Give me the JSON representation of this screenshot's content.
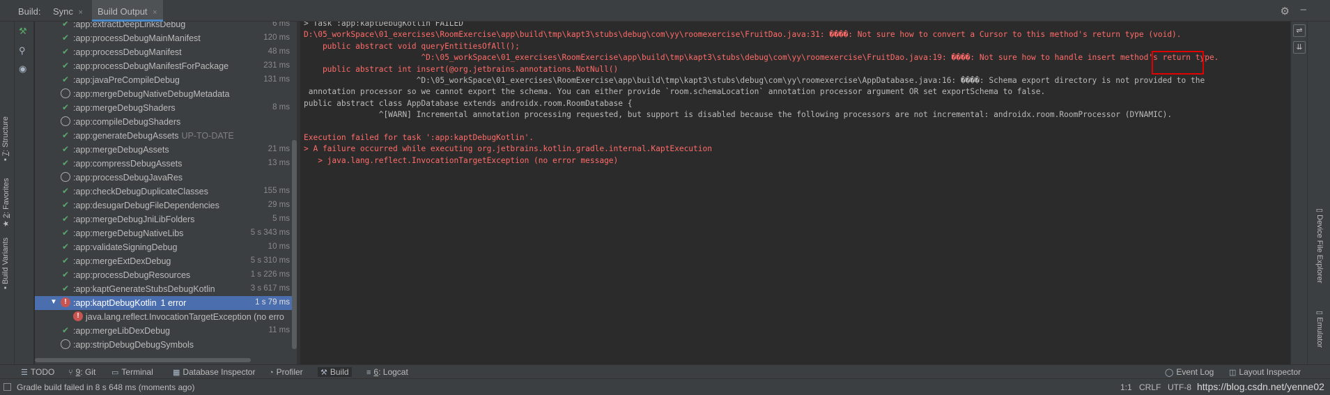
{
  "header": {
    "build_label": "Build:",
    "tabs": [
      {
        "label": "Sync"
      },
      {
        "label": "Build Output"
      }
    ],
    "close_glyph": "×"
  },
  "left_strip": {
    "tabs": [
      {
        "num": "7",
        "label": ": Structure"
      },
      {
        "num": "2",
        "label": ": Favorites"
      },
      {
        "num": "",
        "label": "Build Variants"
      }
    ]
  },
  "tree": {
    "rows": [
      {
        "name": ":app:extractDeepLinksDebug",
        "time": "6 ms",
        "status": "ok"
      },
      {
        "name": ":app:processDebugMainManifest",
        "time": "120 ms",
        "status": "ok"
      },
      {
        "name": ":app:processDebugManifest",
        "time": "48 ms",
        "status": "ok"
      },
      {
        "name": ":app:processDebugManifestForPackage",
        "time": "231 ms",
        "status": "ok"
      },
      {
        "name": ":app:javaPreCompileDebug",
        "time": "131 ms",
        "status": "ok"
      },
      {
        "name": ":app:mergeDebugNativeDebugMetadata",
        "time": "",
        "status": "skip"
      },
      {
        "name": ":app:mergeDebugShaders",
        "time": "8 ms",
        "status": "ok"
      },
      {
        "name": ":app:compileDebugShaders",
        "time": "",
        "status": "skip"
      },
      {
        "name": ":app:generateDebugAssets",
        "suffix": "UP-TO-DATE",
        "time": "",
        "status": "ok"
      },
      {
        "name": ":app:mergeDebugAssets",
        "time": "21 ms",
        "status": "ok"
      },
      {
        "name": ":app:compressDebugAssets",
        "time": "13 ms",
        "status": "ok"
      },
      {
        "name": ":app:processDebugJavaRes",
        "time": "",
        "status": "skip"
      },
      {
        "name": ":app:checkDebugDuplicateClasses",
        "time": "155 ms",
        "status": "ok"
      },
      {
        "name": ":app:desugarDebugFileDependencies",
        "time": "29 ms",
        "status": "ok"
      },
      {
        "name": ":app:mergeDebugJniLibFolders",
        "time": "5 ms",
        "status": "ok"
      },
      {
        "name": ":app:mergeDebugNativeLibs",
        "time": "5 s 343 ms",
        "status": "ok"
      },
      {
        "name": ":app:validateSigningDebug",
        "time": "10 ms",
        "status": "ok"
      },
      {
        "name": ":app:mergeExtDexDebug",
        "time": "5 s 310 ms",
        "status": "ok"
      },
      {
        "name": ":app:processDebugResources",
        "time": "1 s 226 ms",
        "status": "ok"
      },
      {
        "name": ":app:kaptGenerateStubsDebugKotlin",
        "time": "3 s 617 ms",
        "status": "ok"
      },
      {
        "name": ":app:kaptDebugKotlin",
        "errors": "1 error",
        "time": "1 s 79 ms",
        "status": "err",
        "selected": true
      },
      {
        "name": "java.lang.reflect.InvocationTargetException (no erro",
        "time": "",
        "status": "err",
        "child": true
      },
      {
        "name": ":app:mergeLibDexDebug",
        "time": "11 ms",
        "status": "ok"
      },
      {
        "name": ":app:stripDebugDebugSymbols",
        "time": "",
        "status": "skip"
      }
    ]
  },
  "console": {
    "lines": [
      {
        "text": "> Task :app:kaptDebugKotlin FAILED",
        "color": "white"
      },
      {
        "text": "D:\\05_workSpace\\01_exercises\\RoomExercise\\app\\build\\tmp\\kapt3\\stubs\\debug\\com\\yy\\roomexercise\\FruitDao.java:31: ����: Not sure how to convert a Cursor to this method's return type (void).",
        "color": "red"
      },
      {
        "text": "    public abstract void queryEntitiesOfAll();",
        "color": "red"
      },
      {
        "text": "                         ^D:\\05_workSpace\\01_exercises\\RoomExercise\\app\\build\\tmp\\kapt3\\stubs\\debug\\com\\yy\\roomexercise\\FruitDao.java:19: ����: Not sure how to handle insert method's return type.",
        "color": "red"
      },
      {
        "text": "    public abstract int insert(@org.jetbrains.annotations.NotNull()",
        "color": "red"
      },
      {
        "text": "                        ^D:\\05_workSpace\\01_exercises\\RoomExercise\\app\\build\\tmp\\kapt3\\stubs\\debug\\com\\yy\\roomexercise\\AppDatabase.java:16: ����: Schema export directory is not provided to the",
        "color": "white"
      },
      {
        "text": " annotation processor so we cannot export the schema. You can either provide `room.schemaLocation` annotation processor argument OR set exportSchema to false.",
        "color": "white"
      },
      {
        "text": "public abstract class AppDatabase extends androidx.room.RoomDatabase {",
        "color": "white"
      },
      {
        "text": "                ^[WARN] Incremental annotation processing requested, but support is disabled because the following processors are not incremental: androidx.room.RoomProcessor (DYNAMIC).",
        "color": "white"
      },
      {
        "text": "",
        "color": "white"
      },
      {
        "text": "Execution failed for task ':app:kaptDebugKotlin'.",
        "color": "red"
      },
      {
        "text": "> A failure occurred while executing org.jetbrains.kotlin.gradle.internal.KaptExecution",
        "color": "red"
      },
      {
        "text": "   > java.lang.reflect.InvocationTargetException (no error message)",
        "color": "red"
      }
    ]
  },
  "right_strip": {
    "tabs": [
      {
        "label": "Device File Explorer"
      },
      {
        "label": "Emulator"
      }
    ]
  },
  "bottom_tools": [
    {
      "label": "TODO",
      "icon": "list-icon",
      "glyph": "☰"
    },
    {
      "num": "9",
      "label": ": Git",
      "icon": "git-icon",
      "glyph": "⑂"
    },
    {
      "label": "Terminal",
      "icon": "terminal-icon",
      "glyph": "▭"
    },
    {
      "label": "Database Inspector",
      "icon": "database-icon",
      "glyph": "▦"
    },
    {
      "label": "Profiler",
      "icon": "profiler-icon",
      "glyph": "◔"
    },
    {
      "label": "Build",
      "icon": "hammer-icon",
      "glyph": "⚒"
    },
    {
      "num": "6",
      "label": ": Logcat",
      "icon": "logcat-icon",
      "glyph": "≡"
    },
    {
      "label": "Event Log",
      "icon": "event-log-icon",
      "glyph": "◯"
    },
    {
      "label": "Layout Inspector",
      "icon": "layout-inspector-icon",
      "glyph": "◫"
    }
  ],
  "status": {
    "message": "Gradle build failed in 8 s 648 ms (moments ago)",
    "position": "1:1",
    "line_sep": "CRLF",
    "encoding": "UTF-8",
    "watermark": "https://blog.csdn.net/yenne02"
  },
  "colors": {
    "error_text": "#ff6b68",
    "success_check": "#59a869",
    "selection": "#4b6eaf",
    "highlight_box": "#e00000"
  }
}
